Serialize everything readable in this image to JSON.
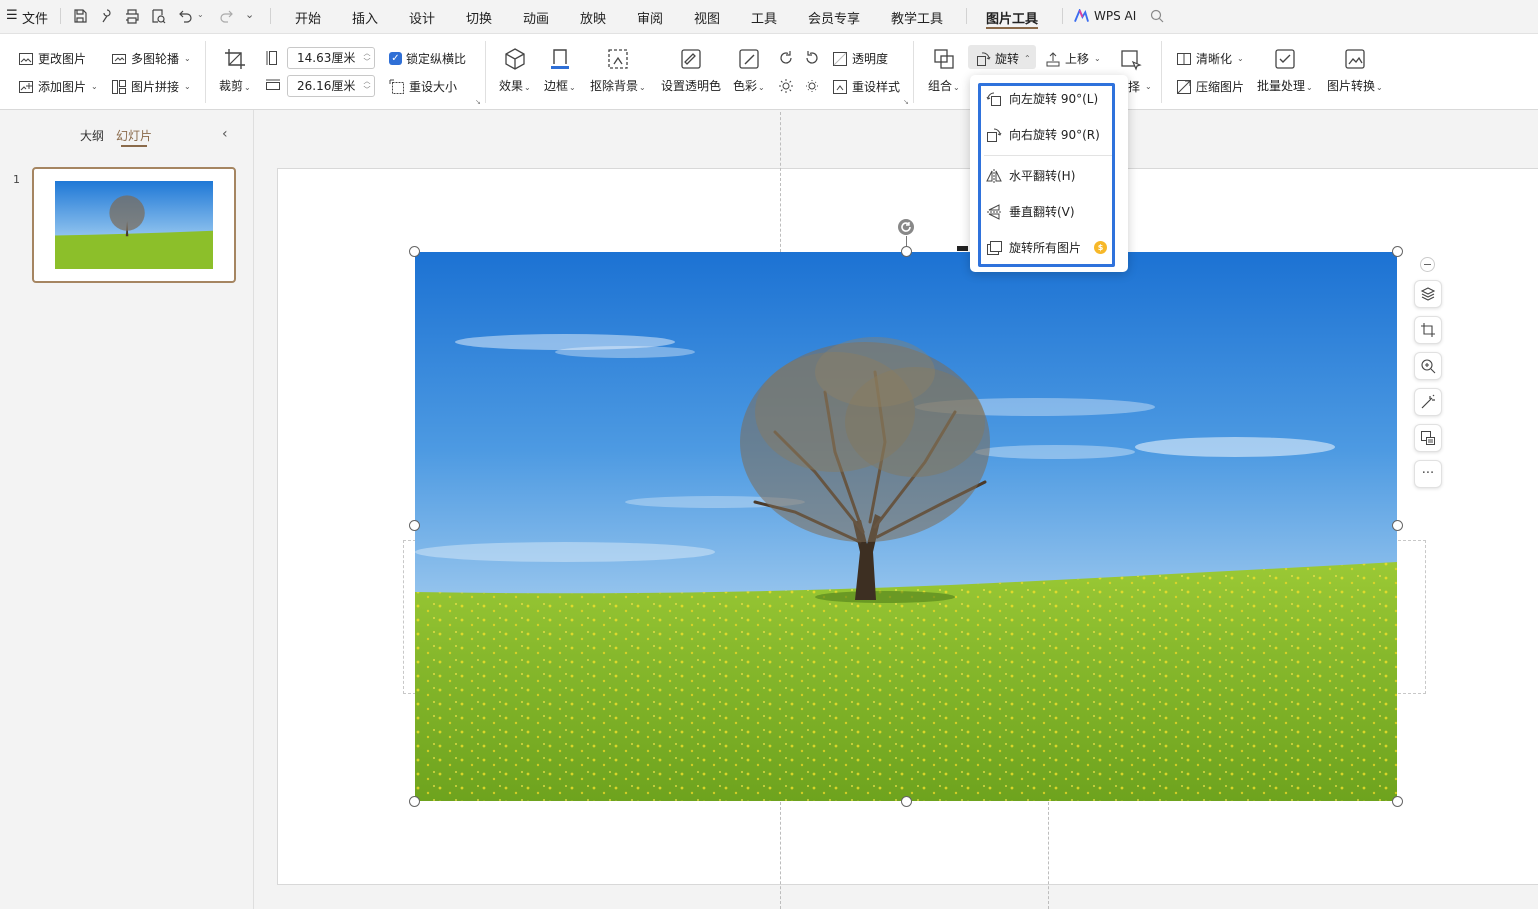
{
  "menu": {
    "hamburger": "☰",
    "file": "文件",
    "tabs": [
      "开始",
      "插入",
      "设计",
      "切换",
      "动画",
      "放映",
      "审阅",
      "视图",
      "工具",
      "会员专享",
      "教学工具",
      "图片工具"
    ],
    "active_tab": "图片工具",
    "wps_ai": "WPS AI"
  },
  "ribbon": {
    "change_picture": "更改图片",
    "multi_carousel": "多图轮播",
    "add_picture": "添加图片",
    "picture_stitch": "图片拼接",
    "crop": "裁剪",
    "height_value": "14.63厘米",
    "width_value": "26.16厘米",
    "lock_aspect": "锁定纵横比",
    "reset_size": "重设大小",
    "effects": "效果",
    "border": "边框",
    "remove_bg": "抠除背景",
    "set_transparent": "设置透明色",
    "color": "色彩",
    "transparency": "透明度",
    "reset_style": "重设样式",
    "group": "组合",
    "rotate": "旋转",
    "move_up": "上移",
    "select_partial": "择",
    "sharpen": "清晰化",
    "compress": "压缩图片",
    "batch": "批量处理",
    "convert": "图片转换"
  },
  "left_panel": {
    "outline_tab": "大纲",
    "slides_tab": "幻灯片",
    "slide_number": "1"
  },
  "rotate_menu": {
    "items": [
      {
        "label": "向左旋转 90°(L)",
        "icon": "rotate-left-icon"
      },
      {
        "label": "向右旋转 90°(R)",
        "icon": "rotate-right-icon"
      },
      {
        "label": "水平翻转(H)",
        "icon": "flip-horizontal-icon"
      },
      {
        "label": "垂直翻转(V)",
        "icon": "flip-vertical-icon"
      },
      {
        "label": "旋转所有图片",
        "icon": "rotate-all-icon",
        "vip": "$"
      }
    ]
  },
  "colors": {
    "accent": "#8a6a4a",
    "highlight": "#2f72dc",
    "checkbox": "#2f6fd6",
    "sky": "#2f86dd",
    "grass": "#8cbf2a"
  }
}
